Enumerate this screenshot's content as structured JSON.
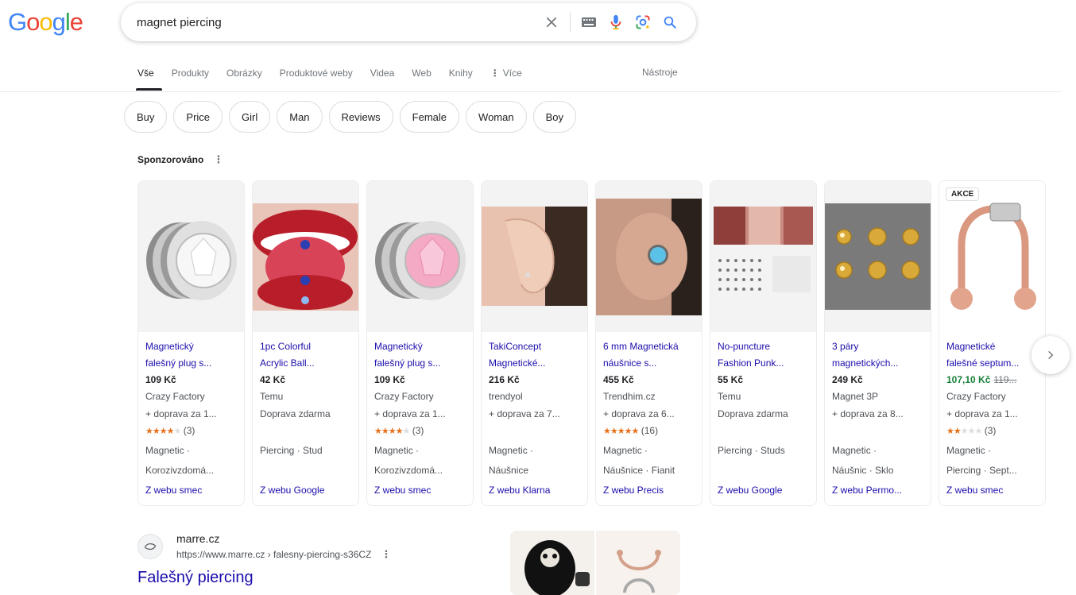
{
  "header": {
    "logo": {
      "letters": [
        "G",
        "o",
        "o",
        "g",
        "l",
        "e"
      ],
      "colors": [
        "#4285F4",
        "#EA4335",
        "#FBBC05",
        "#4285F4",
        "#34A853",
        "#EA4335"
      ]
    },
    "search": {
      "value": "magnet piercing"
    }
  },
  "tabs": {
    "items": [
      {
        "label": "Vše",
        "active": true
      },
      {
        "label": "Produkty"
      },
      {
        "label": "Obrázky"
      },
      {
        "label": "Produktové weby"
      },
      {
        "label": "Videa"
      },
      {
        "label": "Web"
      },
      {
        "label": "Knihy"
      },
      {
        "label": "Více"
      }
    ],
    "tools": "Nástroje"
  },
  "chips": [
    "Buy",
    "Price",
    "Girl",
    "Man",
    "Reviews",
    "Female",
    "Woman",
    "Boy"
  ],
  "sponsored": {
    "label": "Sponzorováno"
  },
  "products": [
    {
      "title1": "Magnetický",
      "title2": "falešný plug s...",
      "price": "109 Kč",
      "seller": "Crazy Factory",
      "shipping": "+ doprava za 1...",
      "rating": 3.5,
      "reviews": "(3)",
      "tag1": "Magnetic ·",
      "tag2": "Korozivzdomá...",
      "source": "Z webu smec",
      "image": "plug-clear"
    },
    {
      "title1": "1pc Colorful",
      "title2": "Acrylic Ball...",
      "price": "42 Kč",
      "seller": "Temu",
      "shipping": "Doprava zdarma",
      "tag1": "Piercing · Stud",
      "tag2": "",
      "source": "Z webu Google",
      "image": "tongue"
    },
    {
      "title1": "Magnetický",
      "title2": "falešný plug s...",
      "price": "109 Kč",
      "seller": "Crazy Factory",
      "shipping": "+ doprava za 1...",
      "rating": 3.5,
      "reviews": "(3)",
      "tag1": "Magnetic ·",
      "tag2": "Korozivzdomá...",
      "source": "Z webu smec",
      "image": "plug-pink"
    },
    {
      "title1": "TakiConcept",
      "title2": "Magnetické...",
      "price": "216 Kč",
      "seller": "trendyol",
      "shipping": "+ doprava za 7...",
      "tag1": "Magnetic ·",
      "tag2": "Náušnice",
      "source": "Z webu Klarna",
      "image": "ear"
    },
    {
      "title1": "6 mm Magnetická",
      "title2": "náušnice s...",
      "price": "455 Kč",
      "seller": "Trendhim.cz",
      "shipping": "+ doprava za 6...",
      "rating": 4.5,
      "reviews": "(16)",
      "tag1": "Magnetic ·",
      "tag2": "Náušnice · Fianit",
      "source": "Z webu Precis",
      "image": "ear-blue"
    },
    {
      "title1": "No-puncture",
      "title2": "Fashion Punk...",
      "price": "55 Kč",
      "seller": "Temu",
      "shipping": "Doprava zdarma",
      "tag1": "Piercing · Studs",
      "tag2": "",
      "source": "Z webu Google",
      "image": "set"
    },
    {
      "title1": "3 páry",
      "title2": "magnetických...",
      "price": "249 Kč",
      "seller": "Magnet 3P",
      "shipping": "+ doprava za 8...",
      "tag1": "Magnetic ·",
      "tag2": "Náušnic · Sklo",
      "source": "Z webu Permo...",
      "image": "gold"
    },
    {
      "title1": "Magnetické",
      "title2": "falešné septum...",
      "price": "107,10 Kč",
      "old_price": "119...",
      "sale": true,
      "seller": "Crazy Factory",
      "shipping": "+ doprava za 1...",
      "rating": 2,
      "reviews": "(3)",
      "tag1": "Magnetic ·",
      "tag2": "Piercing · Sept...",
      "source": "Z webu smec",
      "badge": "AKCE",
      "image": "septum"
    }
  ],
  "result": {
    "site": "marre.cz",
    "url": "https://www.marre.cz › falesny-piercing-s36CZ",
    "title": "Falešný piercing"
  }
}
